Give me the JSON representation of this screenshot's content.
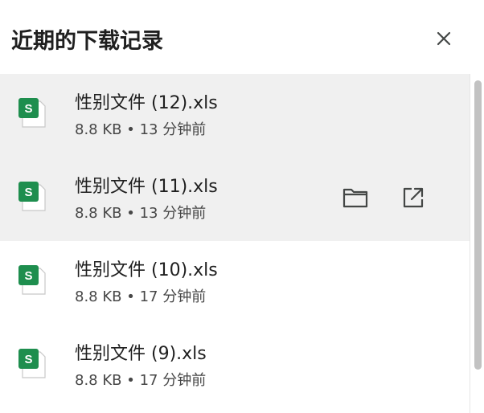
{
  "header": {
    "title": "近期的下载记录",
    "close_icon": "close-icon"
  },
  "downloads": [
    {
      "name": "性别文件 (12).xls",
      "size": "8.8 KB",
      "separator": "•",
      "time": "13 分钟前",
      "icon": "spreadsheet-icon",
      "icon_letter": "S"
    },
    {
      "name": "性别文件 (11).xls",
      "size": "8.8 KB",
      "separator": "•",
      "time": "13 分钟前",
      "icon": "spreadsheet-icon",
      "icon_letter": "S"
    },
    {
      "name": "性别文件 (10).xls",
      "size": "8.8 KB",
      "separator": "•",
      "time": "17 分钟前",
      "icon": "spreadsheet-icon",
      "icon_letter": "S"
    },
    {
      "name": "性别文件 (9).xls",
      "size": "8.8 KB",
      "separator": "•",
      "time": "17 分钟前",
      "icon": "spreadsheet-icon",
      "icon_letter": "S"
    }
  ],
  "actions": {
    "show_in_folder_icon": "folder-icon",
    "open_icon": "open-external-icon"
  },
  "colors": {
    "spreadsheet_green": "#1e8e4e",
    "hover_background": "#f0f0f0",
    "text_primary": "#1f1f1f",
    "text_secondary": "#474747"
  }
}
